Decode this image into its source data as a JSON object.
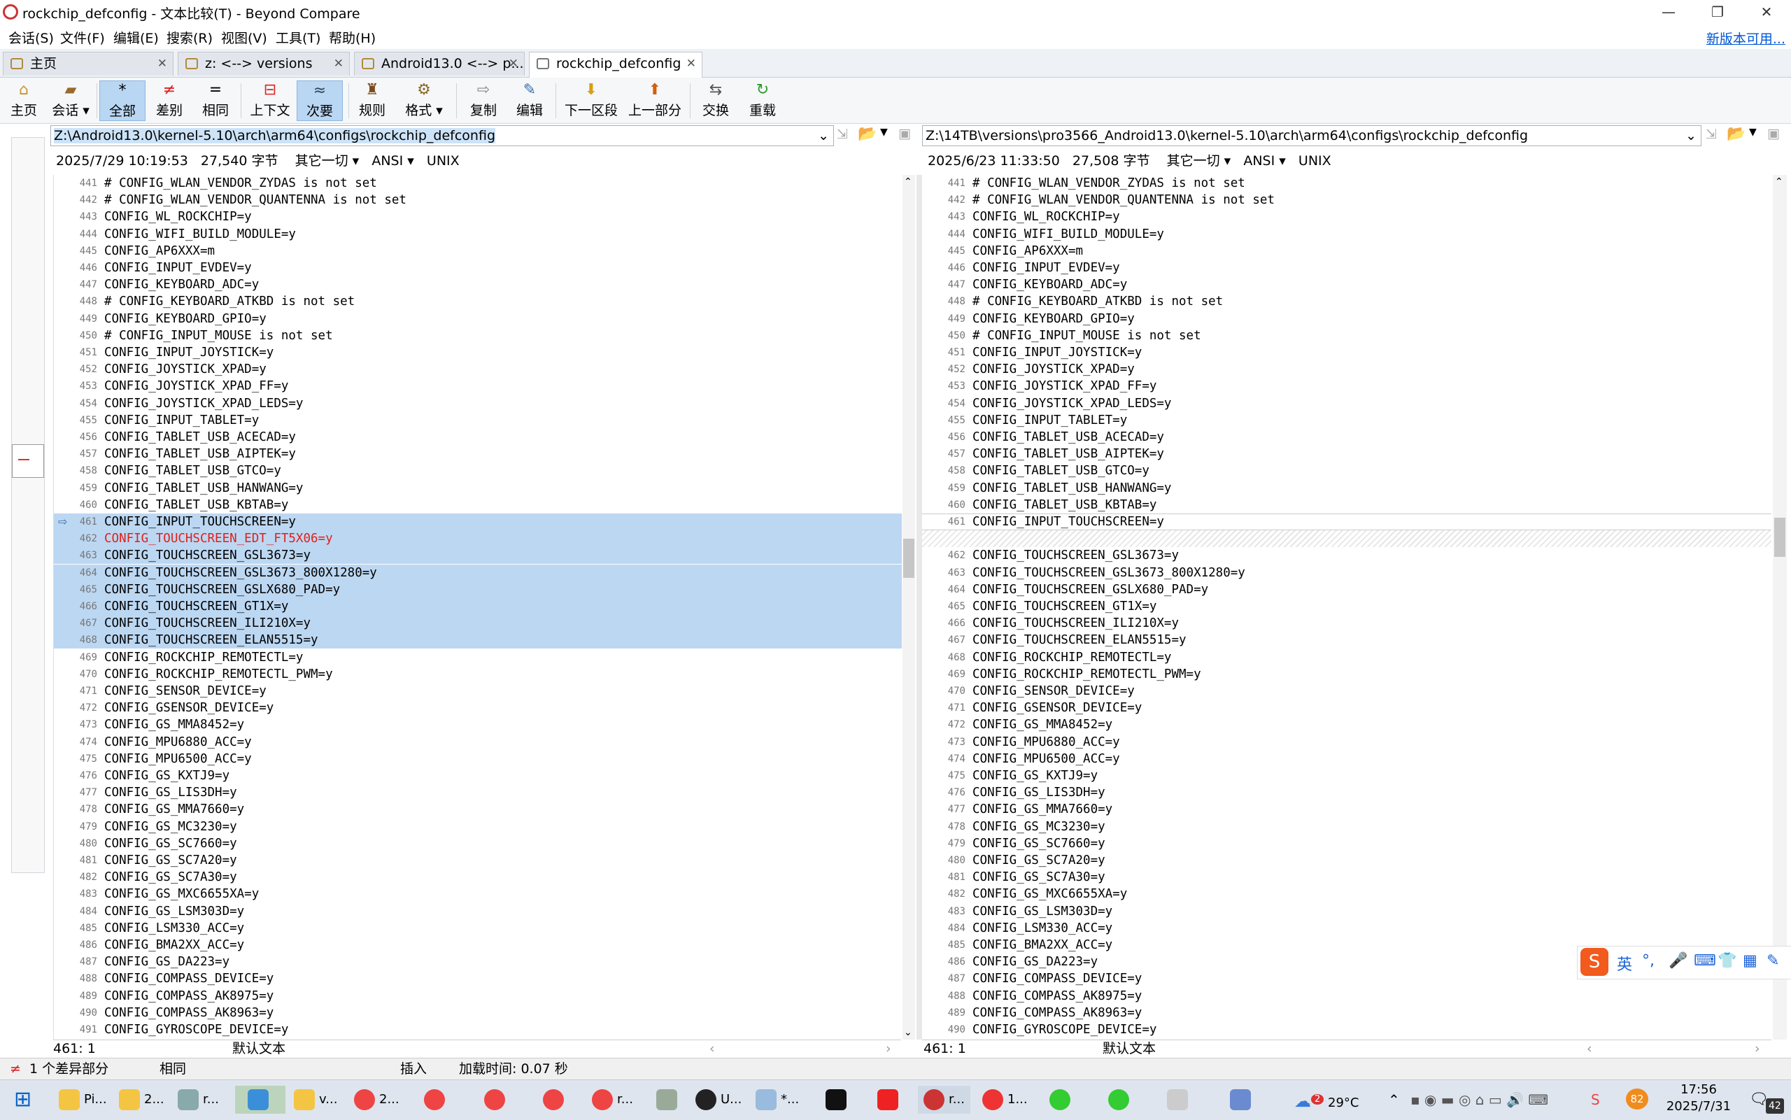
{
  "window": {
    "title": "rockchip_defconfig - 文本比较(T) - Beyond Compare",
    "minimize": "—",
    "restore": "❐",
    "close": "✕"
  },
  "menu": {
    "items": [
      "会话(S)",
      "文件(F)",
      "编辑(E)",
      "搜索(R)",
      "视图(V)",
      "工具(T)",
      "帮助(H)"
    ],
    "new_version": "新版本可用..."
  },
  "tabs": [
    {
      "label": "主页",
      "icon": "home-icon"
    },
    {
      "label": "z: <--> versions",
      "icon": "folder-compare-icon"
    },
    {
      "label": "Android13.0 <--> p...",
      "icon": "folder-compare-icon"
    },
    {
      "label": "rockchip_defconfig",
      "icon": "text-compare-icon",
      "active": true
    }
  ],
  "toolbar": {
    "home": "主页",
    "session": "会话",
    "all": "全部",
    "diffs": "差别",
    "same": "相同",
    "context": "上下文",
    "minor": "次要",
    "rules": "规则",
    "format": "格式",
    "copy": "复制",
    "edit": "编辑",
    "next_section": "下一区段",
    "prev_section": "上一部分",
    "swap": "交换",
    "reload": "重载"
  },
  "left": {
    "path": "Z:\\Android13.0\\kernel-5.10\\arch\\arm64\\configs\\rockchip_defconfig",
    "date": "2025/7/29 10:19:53",
    "size": "27,540 字节",
    "filter": "其它一切",
    "encoding": "ANSI",
    "eol": "UNIX",
    "cursor": "461: 1",
    "status": "默认文本",
    "lines": [
      [
        "441",
        "# CONFIG_WLAN_VENDOR_ZYDAS is not set"
      ],
      [
        "442",
        "# CONFIG_WLAN_VENDOR_QUANTENNA is not set"
      ],
      [
        "443",
        "CONFIG_WL_ROCKCHIP=y"
      ],
      [
        "444",
        "CONFIG_WIFI_BUILD_MODULE=y"
      ],
      [
        "445",
        "CONFIG_AP6XXX=m"
      ],
      [
        "446",
        "CONFIG_INPUT_EVDEV=y"
      ],
      [
        "447",
        "CONFIG_KEYBOARD_ADC=y"
      ],
      [
        "448",
        "# CONFIG_KEYBOARD_ATKBD is not set"
      ],
      [
        "449",
        "CONFIG_KEYBOARD_GPIO=y"
      ],
      [
        "450",
        "# CONFIG_INPUT_MOUSE is not set"
      ],
      [
        "451",
        "CONFIG_INPUT_JOYSTICK=y"
      ],
      [
        "452",
        "CONFIG_JOYSTICK_XPAD=y"
      ],
      [
        "453",
        "CONFIG_JOYSTICK_XPAD_FF=y"
      ],
      [
        "454",
        "CONFIG_JOYSTICK_XPAD_LEDS=y"
      ],
      [
        "455",
        "CONFIG_INPUT_TABLET=y"
      ],
      [
        "456",
        "CONFIG_TABLET_USB_ACECAD=y"
      ],
      [
        "457",
        "CONFIG_TABLET_USB_AIPTEK=y"
      ],
      [
        "458",
        "CONFIG_TABLET_USB_GTCO=y"
      ],
      [
        "459",
        "CONFIG_TABLET_USB_HANWANG=y"
      ],
      [
        "460",
        "CONFIG_TABLET_USB_KBTAB=y"
      ],
      [
        "461",
        "CONFIG_INPUT_TOUCHSCREEN=y"
      ],
      [
        "462",
        "CONFIG_TOUCHSCREEN_EDT_FT5X06=y"
      ],
      [
        "463",
        "CONFIG_TOUCHSCREEN_GSL3673=y"
      ],
      [
        "464",
        "CONFIG_TOUCHSCREEN_GSL3673_800X1280=y"
      ],
      [
        "465",
        "CONFIG_TOUCHSCREEN_GSLX680_PAD=y"
      ],
      [
        "466",
        "CONFIG_TOUCHSCREEN_GT1X=y"
      ],
      [
        "467",
        "CONFIG_TOUCHSCREEN_ILI210X=y"
      ],
      [
        "468",
        "CONFIG_TOUCHSCREEN_ELAN5515=y"
      ],
      [
        "469",
        "CONFIG_ROCKCHIP_REMOTECTL=y"
      ],
      [
        "470",
        "CONFIG_ROCKCHIP_REMOTECTL_PWM=y"
      ],
      [
        "471",
        "CONFIG_SENSOR_DEVICE=y"
      ],
      [
        "472",
        "CONFIG_GSENSOR_DEVICE=y"
      ],
      [
        "473",
        "CONFIG_GS_MMA8452=y"
      ],
      [
        "474",
        "CONFIG_MPU6880_ACC=y"
      ],
      [
        "475",
        "CONFIG_MPU6500_ACC=y"
      ],
      [
        "476",
        "CONFIG_GS_KXTJ9=y"
      ],
      [
        "477",
        "CONFIG_GS_LIS3DH=y"
      ],
      [
        "478",
        "CONFIG_GS_MMA7660=y"
      ],
      [
        "479",
        "CONFIG_GS_MC3230=y"
      ],
      [
        "480",
        "CONFIG_GS_SC7660=y"
      ],
      [
        "481",
        "CONFIG_GS_SC7A20=y"
      ],
      [
        "482",
        "CONFIG_GS_SC7A30=y"
      ],
      [
        "483",
        "CONFIG_GS_MXC6655XA=y"
      ],
      [
        "484",
        "CONFIG_GS_LSM303D=y"
      ],
      [
        "485",
        "CONFIG_LSM330_ACC=y"
      ],
      [
        "486",
        "CONFIG_BMA2XX_ACC=y"
      ],
      [
        "487",
        "CONFIG_GS_DA223=y"
      ],
      [
        "488",
        "CONFIG_COMPASS_DEVICE=y"
      ],
      [
        "489",
        "CONFIG_COMPASS_AK8975=y"
      ],
      [
        "490",
        "CONFIG_COMPASS_AK8963=y"
      ],
      [
        "491",
        "CONFIG_GYROSCOPE_DEVICE=y"
      ]
    ]
  },
  "right": {
    "path": "Z:\\14TB\\versions\\pro3566_Android13.0\\kernel-5.10\\arch\\arm64\\configs\\rockchip_defconfig",
    "date": "2025/6/23 11:33:50",
    "size": "27,508 字节",
    "filter": "其它一切",
    "encoding": "ANSI",
    "eol": "UNIX",
    "cursor": "461: 1",
    "status": "默认文本",
    "lines": [
      [
        "441",
        "# CONFIG_WLAN_VENDOR_ZYDAS is not set"
      ],
      [
        "442",
        "# CONFIG_WLAN_VENDOR_QUANTENNA is not set"
      ],
      [
        "443",
        "CONFIG_WL_ROCKCHIP=y"
      ],
      [
        "444",
        "CONFIG_WIFI_BUILD_MODULE=y"
      ],
      [
        "445",
        "CONFIG_AP6XXX=m"
      ],
      [
        "446",
        "CONFIG_INPUT_EVDEV=y"
      ],
      [
        "447",
        "CONFIG_KEYBOARD_ADC=y"
      ],
      [
        "448",
        "# CONFIG_KEYBOARD_ATKBD is not set"
      ],
      [
        "449",
        "CONFIG_KEYBOARD_GPIO=y"
      ],
      [
        "450",
        "# CONFIG_INPUT_MOUSE is not set"
      ],
      [
        "451",
        "CONFIG_INPUT_JOYSTICK=y"
      ],
      [
        "452",
        "CONFIG_JOYSTICK_XPAD=y"
      ],
      [
        "453",
        "CONFIG_JOYSTICK_XPAD_FF=y"
      ],
      [
        "454",
        "CONFIG_JOYSTICK_XPAD_LEDS=y"
      ],
      [
        "455",
        "CONFIG_INPUT_TABLET=y"
      ],
      [
        "456",
        "CONFIG_TABLET_USB_ACECAD=y"
      ],
      [
        "457",
        "CONFIG_TABLET_USB_AIPTEK=y"
      ],
      [
        "458",
        "CONFIG_TABLET_USB_GTCO=y"
      ],
      [
        "459",
        "CONFIG_TABLET_USB_HANWANG=y"
      ],
      [
        "460",
        "CONFIG_TABLET_USB_KBTAB=y"
      ],
      [
        "461",
        "CONFIG_INPUT_TOUCHSCREEN=y"
      ],
      [
        "",
        ""
      ],
      [
        "462",
        "CONFIG_TOUCHSCREEN_GSL3673=y"
      ],
      [
        "463",
        "CONFIG_TOUCHSCREEN_GSL3673_800X1280=y"
      ],
      [
        "464",
        "CONFIG_TOUCHSCREEN_GSLX680_PAD=y"
      ],
      [
        "465",
        "CONFIG_TOUCHSCREEN_GT1X=y"
      ],
      [
        "466",
        "CONFIG_TOUCHSCREEN_ILI210X=y"
      ],
      [
        "467",
        "CONFIG_TOUCHSCREEN_ELAN5515=y"
      ],
      [
        "468",
        "CONFIG_ROCKCHIP_REMOTECTL=y"
      ],
      [
        "469",
        "CONFIG_ROCKCHIP_REMOTECTL_PWM=y"
      ],
      [
        "470",
        "CONFIG_SENSOR_DEVICE=y"
      ],
      [
        "471",
        "CONFIG_GSENSOR_DEVICE=y"
      ],
      [
        "472",
        "CONFIG_GS_MMA8452=y"
      ],
      [
        "473",
        "CONFIG_MPU6880_ACC=y"
      ],
      [
        "474",
        "CONFIG_MPU6500_ACC=y"
      ],
      [
        "475",
        "CONFIG_GS_KXTJ9=y"
      ],
      [
        "476",
        "CONFIG_GS_LIS3DH=y"
      ],
      [
        "477",
        "CONFIG_GS_MMA7660=y"
      ],
      [
        "478",
        "CONFIG_GS_MC3230=y"
      ],
      [
        "479",
        "CONFIG_GS_SC7660=y"
      ],
      [
        "480",
        "CONFIG_GS_SC7A20=y"
      ],
      [
        "481",
        "CONFIG_GS_SC7A30=y"
      ],
      [
        "482",
        "CONFIG_GS_MXC6655XA=y"
      ],
      [
        "483",
        "CONFIG_GS_LSM303D=y"
      ],
      [
        "484",
        "CONFIG_LSM330_ACC=y"
      ],
      [
        "485",
        "CONFIG_BMA2XX_ACC=y"
      ],
      [
        "486",
        "CONFIG_GS_DA223=y"
      ],
      [
        "487",
        "CONFIG_COMPASS_DEVICE=y"
      ],
      [
        "488",
        "CONFIG_COMPASS_AK8975=y"
      ],
      [
        "489",
        "CONFIG_COMPASS_AK8963=y"
      ],
      [
        "490",
        "CONFIG_GYROSCOPE_DEVICE=y"
      ]
    ]
  },
  "statusbar": {
    "diff_count": "1 个差异部分",
    "same": "相同",
    "mode": "插入",
    "load_time": "加载时间: 0.07 秒"
  },
  "taskbar": {
    "items": [
      "Pi...",
      "2...",
      "r...",
      "v...",
      "2...",
      "r...",
      "U...",
      "*...",
      "r...",
      "1..."
    ],
    "weather": "29°C",
    "weather_badge": "2",
    "time": "17:56",
    "date": "2025/7/31",
    "notif_count": "42",
    "ime_lang": "英",
    "tray_badge": "82"
  },
  "colors": {
    "highlight": "#bcd7f2",
    "diff_text": "#e0201c",
    "accent": "#0057d8"
  }
}
